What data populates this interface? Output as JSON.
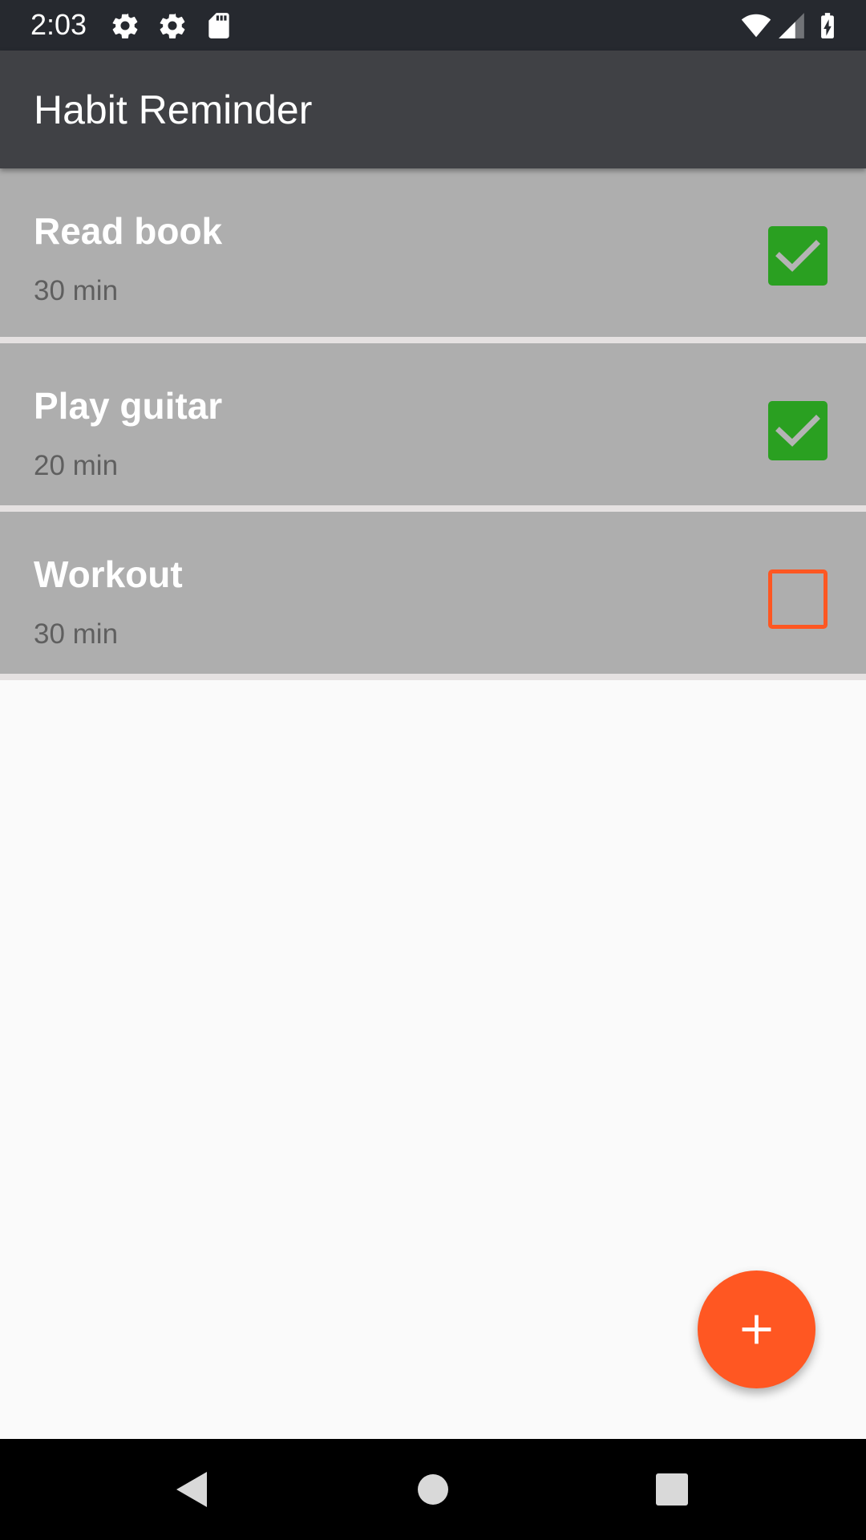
{
  "status_bar": {
    "time": "2:03",
    "left_icons": [
      "gear-icon",
      "gear-icon",
      "sd-card-icon"
    ],
    "right_icons": [
      "wifi-icon",
      "cell-signal-icon",
      "battery-charging-icon"
    ]
  },
  "app_bar": {
    "title": "Habit Reminder",
    "background": "#404145"
  },
  "habits": [
    {
      "name": "Read book",
      "duration": "30 min",
      "done": true
    },
    {
      "name": "Play guitar",
      "duration": "20 min",
      "done": true
    },
    {
      "name": "Workout",
      "duration": "30 min",
      "done": false
    }
  ],
  "colors": {
    "item_background": "#aeaeae",
    "checked": "#2aa021",
    "accent": "#ff5722"
  },
  "fab": {
    "icon": "plus-icon"
  },
  "nav_bar": {
    "icons": [
      "back-icon",
      "home-icon",
      "recents-icon"
    ]
  }
}
